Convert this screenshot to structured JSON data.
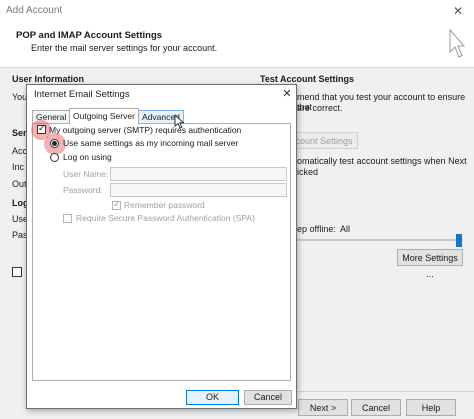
{
  "window": {
    "title": "Add Account",
    "close_glyph": "✕",
    "heading": "POP and IMAP Account Settings",
    "subheading": "Enter the mail server settings for your account.",
    "cursor_icon": "pointer-cursor-icon"
  },
  "background": {
    "user_information": "User Information",
    "test_account_settings": "Test Account Settings",
    "right_line_1": "mend that you test your account to ensure that",
    "right_line_2": "are correct.",
    "test_button": "count Settings ...",
    "auto_test_line_1": "omatically test account settings when Next",
    "auto_test_line_2": "icked",
    "offline_label": "ep offline:",
    "offline_value": "All",
    "offline_slider_level": 1.0,
    "more_settings_button": "More Settings ...",
    "next_button": "Next >",
    "cancel_button": "Cancel",
    "help_button": "Help",
    "cut_labels": [
      "You",
      "Ser",
      "Acc",
      "Inc",
      "Out",
      "Log",
      "Use",
      "Pas"
    ]
  },
  "dialog": {
    "title": "Internet Email Settings",
    "close_glyph": "✕",
    "tabs": [
      {
        "label": "General",
        "active": false
      },
      {
        "label": "Outgoing Server",
        "active": true
      },
      {
        "label": "Advanced",
        "active": false
      }
    ],
    "smtp_auth": {
      "label": "My outgoing server (SMTP) requires authentication",
      "checked": true
    },
    "same_settings": {
      "label": "Use same settings as my incoming mail server",
      "selected": true
    },
    "log_on_using": {
      "label": "Log on using",
      "selected": false
    },
    "user_name_label": "User Name:",
    "password_label": "Password:",
    "remember_password": {
      "label": "Remember password",
      "checked": true
    },
    "spa": {
      "label": "Require Secure Password Authentication (SPA)",
      "checked": false
    },
    "ok_button": "OK",
    "cancel_button": "Cancel",
    "check_glyph": "✓"
  },
  "colors": {
    "accent": "#0078d7",
    "highlight": "#e85050"
  }
}
